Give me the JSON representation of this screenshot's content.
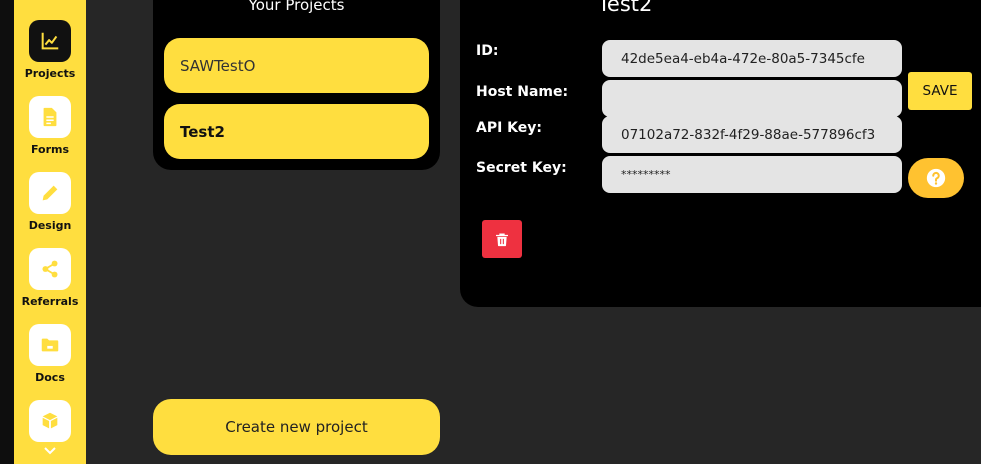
{
  "sidebar": {
    "items": [
      {
        "label": "Projects",
        "icon": "chart-line-icon"
      },
      {
        "label": "Forms",
        "icon": "document-icon"
      },
      {
        "label": "Design",
        "icon": "pencil-icon"
      },
      {
        "label": "Referrals",
        "icon": "share-icon"
      },
      {
        "label": "Docs",
        "icon": "folder-icon"
      },
      {
        "label": "",
        "icon": "box-icon"
      }
    ],
    "more_icon": "chevron-down-icon"
  },
  "projects": {
    "title": "Your Projects",
    "list": [
      {
        "name": "SAWTestO",
        "selected": false
      },
      {
        "name": "Test2",
        "selected": true
      }
    ],
    "create_label": "Create new project"
  },
  "detail": {
    "title": "Test2",
    "fields": {
      "id": {
        "label": "ID:",
        "value": "42de5ea4-eb4a-472e-80a5-7345cfe"
      },
      "host_name": {
        "label": "Host Name:",
        "value": ""
      },
      "api_key": {
        "label": "API Key:",
        "value": "07102a72-832f-4f29-88ae-577896cf3"
      },
      "secret_key": {
        "label": "Secret Key:",
        "value": "*********"
      }
    },
    "save_label": "SAVE",
    "help_icon": "question-circle-icon",
    "delete_icon": "trash-icon"
  },
  "colors": {
    "accent_yellow": "#ffde3f",
    "help_orange": "#ffc230",
    "danger_red": "#ee3140",
    "panel_black": "#000000",
    "background": "#262626",
    "input_gray": "#e4e4e4"
  }
}
